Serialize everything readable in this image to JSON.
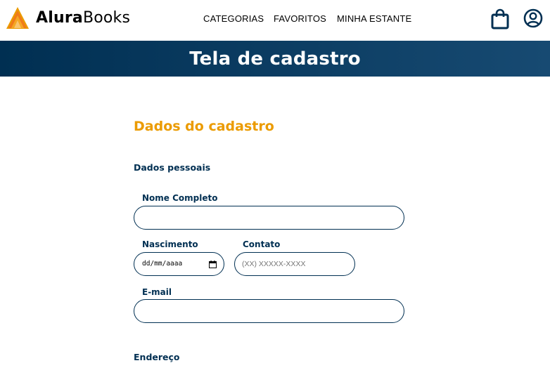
{
  "brand": {
    "name_bold": "Alura",
    "name_light": "Books",
    "accent": "#EB9B00",
    "primary": "#002F52"
  },
  "nav": {
    "items": [
      {
        "label": "CATEGORIAS"
      },
      {
        "label": "FAVORITOS"
      },
      {
        "label": "MINHA ESTANTE"
      }
    ],
    "icons": [
      "shopping-bag-icon",
      "user-account-icon"
    ]
  },
  "banner": {
    "title": "Tela de cadastro"
  },
  "form": {
    "section_title": "Dados do cadastro",
    "personal_heading": "Dados pessoais",
    "fields": {
      "nome": {
        "label": "Nome Completo",
        "value": ""
      },
      "nascimento": {
        "label": "Nascimento",
        "value_display": "dd/mm/aaaa"
      },
      "contato": {
        "label": "Contato",
        "placeholder": "(XX) XXXXX-XXXX"
      },
      "email": {
        "label": "E-mail",
        "value": ""
      }
    },
    "address_heading": "Endereço"
  }
}
